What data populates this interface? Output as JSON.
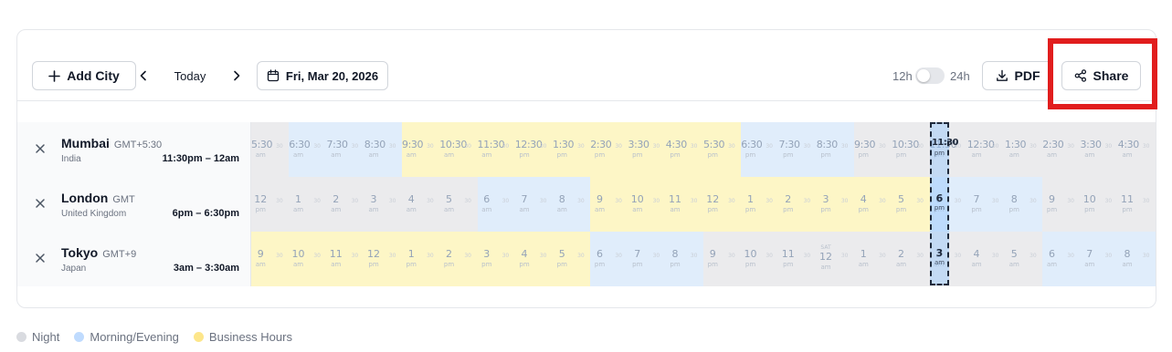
{
  "toolbar": {
    "add_city_label": "Add City",
    "today_label": "Today",
    "date_label": "Fri, Mar 20, 2026",
    "toggle_12h_label": "12h",
    "toggle_24h_label": "24h",
    "pdf_label": "PDF",
    "share_label": "Share"
  },
  "icons": {
    "add": "plus-icon",
    "prev": "chevron-left-icon",
    "next": "chevron-right-icon",
    "calendar": "calendar-icon",
    "pdf": "download-icon",
    "share": "share-icon",
    "remove": "close-icon"
  },
  "colors": {
    "night": "#ebebed",
    "morning_evening": "#e0edfb",
    "business": "#fdf6c6",
    "highlight": "#e11d1d",
    "current": "#93c5fd"
  },
  "cities": [
    {
      "name": "Mumbai",
      "offset": "GMT+5:30",
      "country": "India",
      "range": "11:30pm – 12am",
      "cells": [
        {
          "t": "5:30",
          "ap": "am",
          "k": "night",
          "m": true
        },
        {
          "t": "6:30",
          "ap": "am",
          "k": "morn",
          "m": true
        },
        {
          "t": "7:30",
          "ap": "am",
          "k": "morn",
          "m": true
        },
        {
          "t": "8:30",
          "ap": "am",
          "k": "morn",
          "m": true
        },
        {
          "t": "9:30",
          "ap": "am",
          "k": "biz",
          "m": true
        },
        {
          "t": "10:30",
          "ap": "am",
          "k": "biz",
          "m": true
        },
        {
          "t": "11:30",
          "ap": "am",
          "k": "biz",
          "m": true
        },
        {
          "t": "12:30",
          "ap": "pm",
          "k": "biz",
          "m": true
        },
        {
          "t": "1:30",
          "ap": "pm",
          "k": "biz",
          "m": true
        },
        {
          "t": "2:30",
          "ap": "pm",
          "k": "biz",
          "m": true
        },
        {
          "t": "3:30",
          "ap": "pm",
          "k": "biz",
          "m": true
        },
        {
          "t": "4:30",
          "ap": "pm",
          "k": "biz",
          "m": true
        },
        {
          "t": "5:30",
          "ap": "pm",
          "k": "biz",
          "m": true
        },
        {
          "t": "6:30",
          "ap": "pm",
          "k": "morn",
          "m": true
        },
        {
          "t": "7:30",
          "ap": "pm",
          "k": "morn",
          "m": true
        },
        {
          "t": "8:30",
          "ap": "pm",
          "k": "morn",
          "m": true
        },
        {
          "t": "9:30",
          "ap": "pm",
          "k": "night",
          "m": true
        },
        {
          "t": "10:30",
          "ap": "pm",
          "k": "night",
          "m": true
        },
        {
          "t": "11:30",
          "ap": "pm",
          "k": "night",
          "m": true
        },
        {
          "t": "12:30",
          "ap": "am",
          "k": "night",
          "m": true
        },
        {
          "t": "1:30",
          "ap": "am",
          "k": "night",
          "m": true
        },
        {
          "t": "2:30",
          "ap": "am",
          "k": "night",
          "m": true
        },
        {
          "t": "3:30",
          "ap": "am",
          "k": "night",
          "m": true
        },
        {
          "t": "4:30",
          "ap": "am",
          "k": "night",
          "m": true
        }
      ]
    },
    {
      "name": "London",
      "offset": "GMT",
      "country": "United Kingdom",
      "range": "6pm – 6:30pm",
      "cells": [
        {
          "t": "12",
          "ap": "pm",
          "k": "night"
        },
        {
          "t": "1",
          "ap": "am",
          "k": "night"
        },
        {
          "t": "2",
          "ap": "am",
          "k": "night"
        },
        {
          "t": "3",
          "ap": "am",
          "k": "night"
        },
        {
          "t": "4",
          "ap": "am",
          "k": "night"
        },
        {
          "t": "5",
          "ap": "am",
          "k": "night"
        },
        {
          "t": "6",
          "ap": "am",
          "k": "morn"
        },
        {
          "t": "7",
          "ap": "am",
          "k": "morn"
        },
        {
          "t": "8",
          "ap": "am",
          "k": "morn"
        },
        {
          "t": "9",
          "ap": "am",
          "k": "biz"
        },
        {
          "t": "10",
          "ap": "am",
          "k": "biz"
        },
        {
          "t": "11",
          "ap": "am",
          "k": "biz"
        },
        {
          "t": "12",
          "ap": "pm",
          "k": "biz"
        },
        {
          "t": "1",
          "ap": "pm",
          "k": "biz"
        },
        {
          "t": "2",
          "ap": "pm",
          "k": "biz"
        },
        {
          "t": "3",
          "ap": "pm",
          "k": "biz"
        },
        {
          "t": "4",
          "ap": "pm",
          "k": "biz"
        },
        {
          "t": "5",
          "ap": "pm",
          "k": "biz"
        },
        {
          "t": "6",
          "ap": "pm",
          "k": "morn"
        },
        {
          "t": "7",
          "ap": "pm",
          "k": "morn"
        },
        {
          "t": "8",
          "ap": "pm",
          "k": "morn"
        },
        {
          "t": "9",
          "ap": "pm",
          "k": "night"
        },
        {
          "t": "10",
          "ap": "pm",
          "k": "night"
        },
        {
          "t": "11",
          "ap": "pm",
          "k": "night"
        }
      ]
    },
    {
      "name": "Tokyo",
      "offset": "GMT+9",
      "country": "Japan",
      "range": "3am – 3:30am",
      "cells": [
        {
          "t": "9",
          "ap": "am",
          "k": "biz"
        },
        {
          "t": "10",
          "ap": "am",
          "k": "biz"
        },
        {
          "t": "11",
          "ap": "am",
          "k": "biz"
        },
        {
          "t": "12",
          "ap": "pm",
          "k": "biz"
        },
        {
          "t": "1",
          "ap": "pm",
          "k": "biz"
        },
        {
          "t": "2",
          "ap": "pm",
          "k": "biz"
        },
        {
          "t": "3",
          "ap": "pm",
          "k": "biz"
        },
        {
          "t": "4",
          "ap": "pm",
          "k": "biz"
        },
        {
          "t": "5",
          "ap": "pm",
          "k": "biz"
        },
        {
          "t": "6",
          "ap": "pm",
          "k": "morn"
        },
        {
          "t": "7",
          "ap": "pm",
          "k": "morn"
        },
        {
          "t": "8",
          "ap": "pm",
          "k": "morn"
        },
        {
          "t": "9",
          "ap": "pm",
          "k": "night"
        },
        {
          "t": "10",
          "ap": "pm",
          "k": "night"
        },
        {
          "t": "11",
          "ap": "pm",
          "k": "night"
        },
        {
          "t": "12",
          "ap": "am",
          "k": "night",
          "sat": "SAT"
        },
        {
          "t": "1",
          "ap": "am",
          "k": "night"
        },
        {
          "t": "2",
          "ap": "am",
          "k": "night"
        },
        {
          "t": "3",
          "ap": "am",
          "k": "night"
        },
        {
          "t": "4",
          "ap": "am",
          "k": "night"
        },
        {
          "t": "5",
          "ap": "am",
          "k": "night"
        },
        {
          "t": "6",
          "ap": "am",
          "k": "morn"
        },
        {
          "t": "7",
          "ap": "am",
          "k": "morn"
        },
        {
          "t": "8",
          "ap": "am",
          "k": "morn"
        }
      ]
    }
  ],
  "half_marker": "30",
  "current": {
    "mumbai": {
      "t": "11:30",
      "ap": "pm"
    },
    "london": {
      "t": "6",
      "ap": "pm"
    },
    "tokyo": {
      "t": "3",
      "ap": "am"
    }
  },
  "legend": [
    {
      "label": "Night",
      "color": "#d9dbe0"
    },
    {
      "label": "Morning/Evening",
      "color": "#bfdbfe"
    },
    {
      "label": "Business Hours",
      "color": "#fde68a"
    }
  ]
}
